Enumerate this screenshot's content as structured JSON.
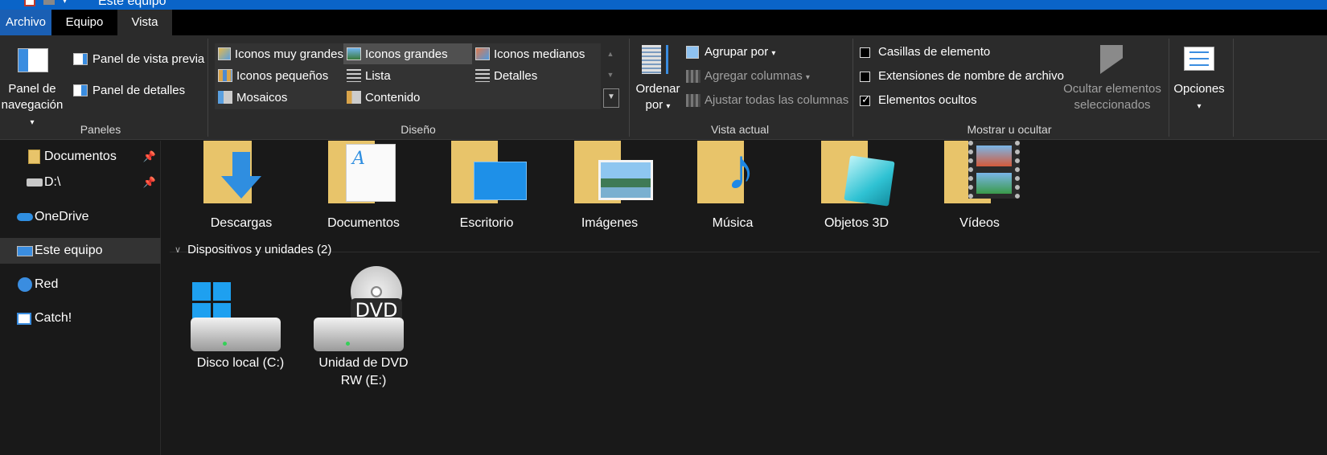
{
  "window": {
    "title": "Este equipo"
  },
  "tabs": [
    {
      "label": "Archivo"
    },
    {
      "label": "Equipo"
    },
    {
      "label": "Vista"
    }
  ],
  "ribbon": {
    "paneles": {
      "nav_pane": "Panel de navegación",
      "preview_pane": "Panel de vista previa",
      "details_pane": "Panel de detalles",
      "group_label": "Paneles"
    },
    "diseno": {
      "group_label": "Diseño",
      "items": [
        {
          "label": "Iconos muy grandes",
          "selected": false
        },
        {
          "label": "Iconos grandes",
          "selected": true
        },
        {
          "label": "Iconos medianos",
          "selected": false
        },
        {
          "label": "Iconos pequeños",
          "selected": false
        },
        {
          "label": "Lista",
          "selected": false
        },
        {
          "label": "Detalles",
          "selected": false
        },
        {
          "label": "Mosaicos",
          "selected": false
        },
        {
          "label": "Contenido",
          "selected": false
        }
      ]
    },
    "vista_actual": {
      "group_label": "Vista actual",
      "sort_by": "Ordenar por",
      "group_by": "Agrupar por",
      "add_columns": "Agregar columnas",
      "fit_columns": "Ajustar todas las columnas"
    },
    "mostrar": {
      "group_label": "Mostrar u ocultar",
      "item_checkboxes": {
        "label": "Casillas de elemento",
        "checked": false
      },
      "extensions": {
        "label": "Extensiones de nombre de archivo",
        "checked": false
      },
      "hidden_items": {
        "label": "Elementos ocultos",
        "checked": true
      },
      "hide_selected": "Ocultar elementos seleccionados"
    },
    "opciones": {
      "label": "Opciones"
    }
  },
  "sidebar": {
    "items": [
      {
        "label": "Documentos",
        "pinned": true
      },
      {
        "label": "D:\\",
        "pinned": true
      },
      {
        "label": "OneDrive"
      },
      {
        "label": "Este equipo",
        "selected": true
      },
      {
        "label": "Red"
      },
      {
        "label": "Catch!"
      }
    ]
  },
  "folders": [
    {
      "label": "Descargas"
    },
    {
      "label": "Documentos"
    },
    {
      "label": "Escritorio"
    },
    {
      "label": "Imágenes"
    },
    {
      "label": "Música"
    },
    {
      "label": "Objetos 3D"
    },
    {
      "label": "Vídeos"
    }
  ],
  "devices": {
    "header": "Dispositivos y unidades (2)",
    "items": [
      {
        "label": "Disco local (C:)"
      },
      {
        "label": "Unidad de DVD RW (E:)"
      }
    ]
  },
  "colors": {
    "accent": "#0a64c8",
    "tab_selected": "#1a5fb4",
    "background": "#191919",
    "ribbon": "#2b2b2b"
  }
}
